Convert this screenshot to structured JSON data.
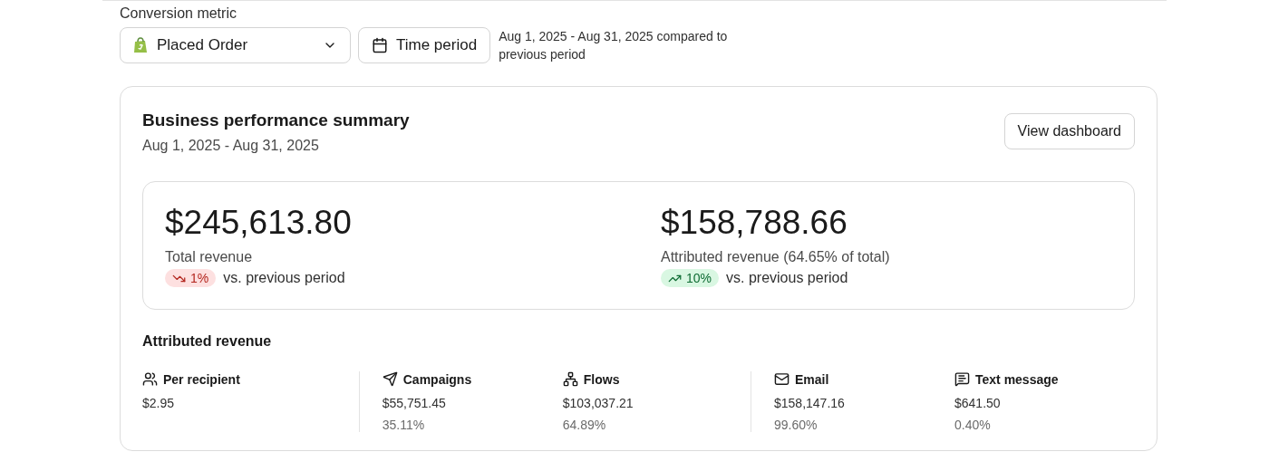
{
  "conversion_metric": {
    "label": "Conversion metric",
    "value": "Placed Order",
    "time_button": "Time period",
    "period_note": "Aug 1, 2025 - Aug 31, 2025 compared to previous period"
  },
  "summary": {
    "title": "Business performance summary",
    "date_range": "Aug 1, 2025 - Aug 31, 2025",
    "button": "View dashboard",
    "totals": [
      {
        "amount": "$245,613.80",
        "label": "Total revenue",
        "change": "1%",
        "kind": "down",
        "comparison": "vs. previous period"
      },
      {
        "amount": "$158,788.66",
        "label": "Attributed revenue (64.65% of total)",
        "change": "10%",
        "kind": "up",
        "comparison": "vs. previous period"
      }
    ],
    "attributed": {
      "title": "Attributed revenue",
      "groups": [
        [
          {
            "kind": "recipient",
            "label": "Per recipient",
            "value": "$2.95"
          }
        ],
        [
          {
            "kind": "campaigns",
            "label": "Campaigns",
            "value": "$55,751.45",
            "share": "35.11%"
          },
          {
            "kind": "flows",
            "label": "Flows",
            "value": "$103,037.21",
            "share": "64.89%"
          }
        ],
        [
          {
            "kind": "email",
            "label": "Email",
            "value": "$158,147.16",
            "share": "99.60%"
          },
          {
            "kind": "sms",
            "label": "Text message",
            "value": "$641.50",
            "share": "0.40%"
          }
        ]
      ]
    }
  }
}
